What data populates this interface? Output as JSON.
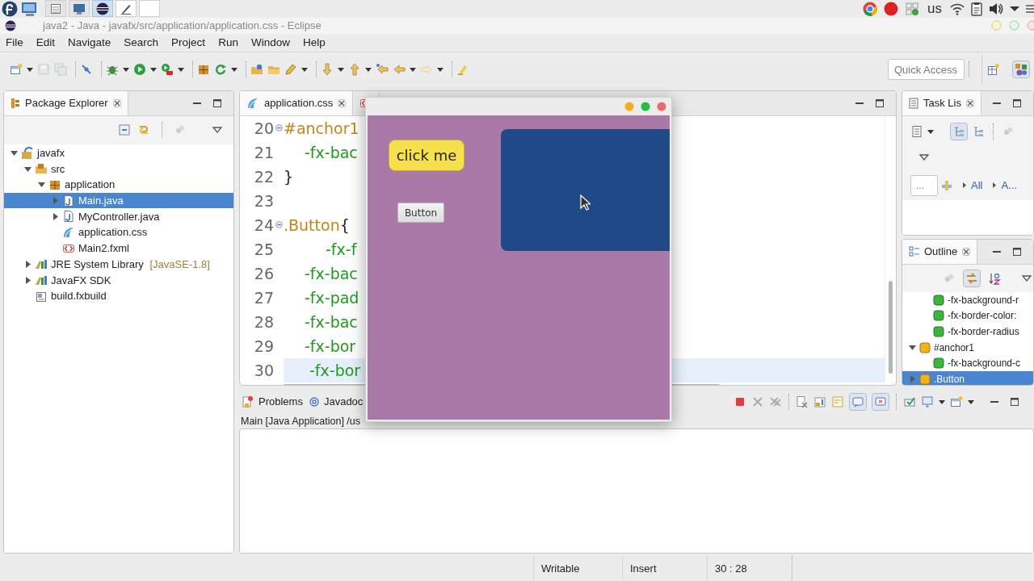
{
  "desktop_panel": {
    "keyboard_layout": "us"
  },
  "window": {
    "title": "java2 - Java - javafx/src/application/application.css - Eclipse"
  },
  "menu": [
    "File",
    "Edit",
    "Navigate",
    "Search",
    "Project",
    "Run",
    "Window",
    "Help"
  ],
  "toolbar": {
    "quick_access": {
      "placeholder": "Quick Access"
    }
  },
  "package_explorer": {
    "tab": "Package Explorer",
    "tree": [
      {
        "label": "javafx",
        "kind": "project",
        "expanded": true,
        "selected": false,
        "children": [
          {
            "label": "src",
            "kind": "source-folder",
            "expanded": true,
            "selected": false,
            "children": [
              {
                "label": "application",
                "kind": "package",
                "expanded": true,
                "selected": false,
                "children": [
                  {
                    "label": "Main.java",
                    "kind": "java-file",
                    "expanded": false,
                    "selected": true
                  },
                  {
                    "label": "MyController.java",
                    "kind": "java-file",
                    "expanded": false,
                    "selected": false
                  },
                  {
                    "label": "application.css",
                    "kind": "css-file",
                    "selected": false
                  },
                  {
                    "label": "Main2.fxml",
                    "kind": "fxml-file",
                    "selected": false
                  }
                ]
              }
            ]
          },
          {
            "label": "JRE System Library",
            "decoration": "[JavaSE-1.8]",
            "kind": "library",
            "expanded": false,
            "selected": false
          },
          {
            "label": "JavaFX SDK",
            "kind": "library",
            "expanded": false,
            "selected": false
          },
          {
            "label": "build.fxbuild",
            "kind": "build-file",
            "selected": false
          }
        ]
      }
    ]
  },
  "editor": {
    "tabs": [
      {
        "kind": "css-file",
        "label": "application.css",
        "selected": true
      },
      {
        "kind": "fxml-file",
        "selected": false
      }
    ],
    "lines": [
      {
        "number": "20",
        "fold": true,
        "current": false,
        "tokens": [
          {
            "kind": "selector",
            "text": "#anchor1"
          }
        ]
      },
      {
        "number": "21",
        "fold": false,
        "current": false,
        "tokens": [
          {
            "kind": "property",
            "text": "-fx-bac"
          }
        ]
      },
      {
        "number": "22",
        "fold": false,
        "current": false,
        "tokens": [
          {
            "kind": "brace",
            "text": "}"
          }
        ]
      },
      {
        "number": "23",
        "fold": false,
        "current": false
      },
      {
        "number": "24",
        "fold": true,
        "current": false,
        "tokens": [
          {
            "kind": "selector",
            "text": ".Button"
          },
          {
            "kind": "brace",
            "text": "{"
          }
        ]
      },
      {
        "number": "25",
        "fold": false,
        "current": false,
        "tokens": [
          {
            "kind": "nested-property",
            "text": "-fx-f"
          }
        ]
      },
      {
        "number": "26",
        "fold": false,
        "current": false,
        "tokens": [
          {
            "kind": "property",
            "text": "-fx-bac"
          }
        ]
      },
      {
        "number": "27",
        "fold": false,
        "current": false,
        "tokens": [
          {
            "kind": "property",
            "text": "-fx-pad"
          }
        ]
      },
      {
        "number": "28",
        "fold": false,
        "current": false,
        "tokens": [
          {
            "kind": "property",
            "text": "-fx-bac"
          }
        ]
      },
      {
        "number": "29",
        "fold": false,
        "current": false,
        "tokens": [
          {
            "kind": "property",
            "text": "-fx-bor"
          }
        ]
      },
      {
        "number": "30",
        "fold": false,
        "current": true,
        "tokens": [
          {
            "kind": "property",
            "text": "-fx-bor"
          }
        ]
      }
    ]
  },
  "task_list": {
    "tab": "Task Lis",
    "find_field": {
      "placeholder": "..."
    },
    "filters": [
      "All",
      "A..."
    ]
  },
  "outline": {
    "tab": "Outline",
    "partial_children": [
      {
        "label": "-fx-background-r",
        "kind": "property",
        "selected": false
      },
      {
        "label": "-fx-border-color:",
        "kind": "property",
        "selected": false
      },
      {
        "label": "-fx-border-radius",
        "kind": "property",
        "selected": false
      }
    ],
    "tree": [
      {
        "label": "#anchor1",
        "kind": "rule",
        "expanded": true,
        "selected": false,
        "children": [
          {
            "label": "-fx-background-c",
            "kind": "property",
            "selected": false
          }
        ]
      },
      {
        "label": ".Button",
        "kind": "rule",
        "expanded": false,
        "selected": true
      }
    ]
  },
  "console": {
    "tabs": [
      {
        "kind": "problems",
        "label": "Problems"
      },
      {
        "kind": "javadoc",
        "label": "Javadoc"
      }
    ],
    "process": "Main [Java Application] /us"
  },
  "status_bar": [
    "Writable",
    "Insert",
    "30 : 28"
  ],
  "fx_window": {
    "buttons": [
      {
        "kind": "styled",
        "label": "click me"
      },
      {
        "kind": "plain",
        "label": "Button"
      }
    ]
  }
}
